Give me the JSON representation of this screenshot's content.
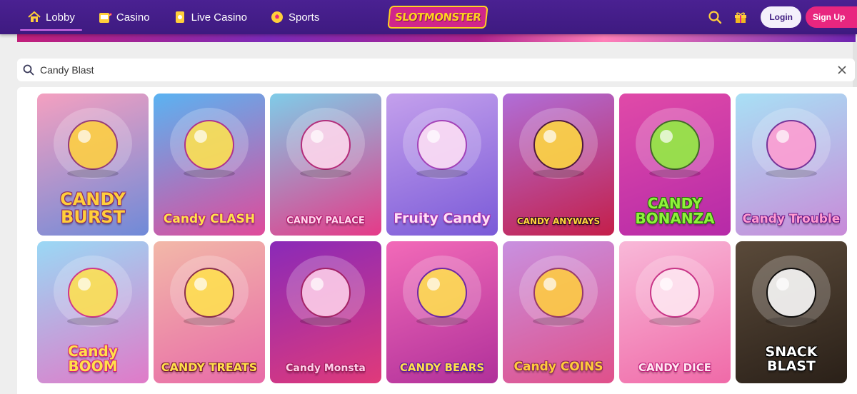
{
  "nav": {
    "items": [
      {
        "label": "Lobby",
        "icon": "home-icon"
      },
      {
        "label": "Casino",
        "icon": "slot-machine-icon"
      },
      {
        "label": "Live Casino",
        "icon": "card-icon"
      },
      {
        "label": "Sports",
        "icon": "soccer-ball-icon"
      }
    ],
    "active": "Lobby"
  },
  "logo": {
    "text": "SLOTMONSTER"
  },
  "header_actions": {
    "login_label": "Login",
    "signup_label": "Sign Up",
    "search_icon": "search-icon",
    "gift_icon": "gift-icon"
  },
  "search": {
    "value": "Candy Blast",
    "placeholder": ""
  },
  "colors": {
    "header": "#4a2192",
    "accent_pink": "#e8267f",
    "logo_yellow": "#ffd21f"
  },
  "games": [
    {
      "title": "CANDY BURST",
      "bg": [
        "#f4a0c0",
        "#6f8ad8"
      ],
      "fg": "#ffcf3a",
      "stroke": "#8a2a6a",
      "size": 24
    },
    {
      "title": "Candy CLASH",
      "bg": [
        "#5ab3f2",
        "#e04a9a"
      ],
      "fg": "#ffe24a",
      "stroke": "#b02080",
      "size": 17
    },
    {
      "title": "CANDY PALACE",
      "bg": [
        "#7fcce8",
        "#e53a88"
      ],
      "fg": "#ffd6ec",
      "stroke": "#b3186c",
      "size": 13
    },
    {
      "title": "Fruity Candy",
      "bg": [
        "#c4a0ec",
        "#7a5ad8"
      ],
      "fg": "#ffe0f5",
      "stroke": "#a032b0",
      "size": 19
    },
    {
      "title": "CANDY ANYWAYS",
      "bg": [
        "#b06ed8",
        "#c41f4a"
      ],
      "fg": "#ffd83a",
      "stroke": "#3a0a2a",
      "size": 12
    },
    {
      "title": "CANDY BONANZA",
      "bg": [
        "#e04aa8",
        "#b62aa8"
      ],
      "fg": "#8ef23a",
      "stroke": "#2a6a10",
      "size": 20
    },
    {
      "title": "Candy Trouble",
      "bg": [
        "#a8e0f5",
        "#c88ad8"
      ],
      "fg": "#ff9ad0",
      "stroke": "#6a1a8a",
      "size": 17
    },
    {
      "title": "Candy BOOM",
      "bg": [
        "#9ad8f5",
        "#e07ac8"
      ],
      "fg": "#ffe04a",
      "stroke": "#d0207a",
      "size": 20
    },
    {
      "title": "CANDY TREATS",
      "bg": [
        "#f2b8a8",
        "#e86aa8"
      ],
      "fg": "#ffe04a",
      "stroke": "#7a1a3a",
      "size": 16
    },
    {
      "title": "Candy Monsta",
      "bg": [
        "#8a2ab8",
        "#e03a7a"
      ],
      "fg": "#ffd0ea",
      "stroke": "#a01a5a",
      "size": 14
    },
    {
      "title": "CANDY BEARS",
      "bg": [
        "#f26ab8",
        "#b0309a"
      ],
      "fg": "#ffe04a",
      "stroke": "#5a1aa0",
      "size": 15
    },
    {
      "title": "Candy COINS",
      "bg": [
        "#c890e0",
        "#e0508a"
      ],
      "fg": "#ffcc3a",
      "stroke": "#8a2a5a",
      "size": 17
    },
    {
      "title": "CANDY DICE",
      "bg": [
        "#f8b8d8",
        "#f06aa8"
      ],
      "fg": "#ffe8f2",
      "stroke": "#c0207a",
      "size": 15
    },
    {
      "title": "SNACK BLAST",
      "bg": [
        "#5a4a3a",
        "#2a2018"
      ],
      "fg": "#ffffff",
      "stroke": "#000000",
      "size": 19
    }
  ]
}
